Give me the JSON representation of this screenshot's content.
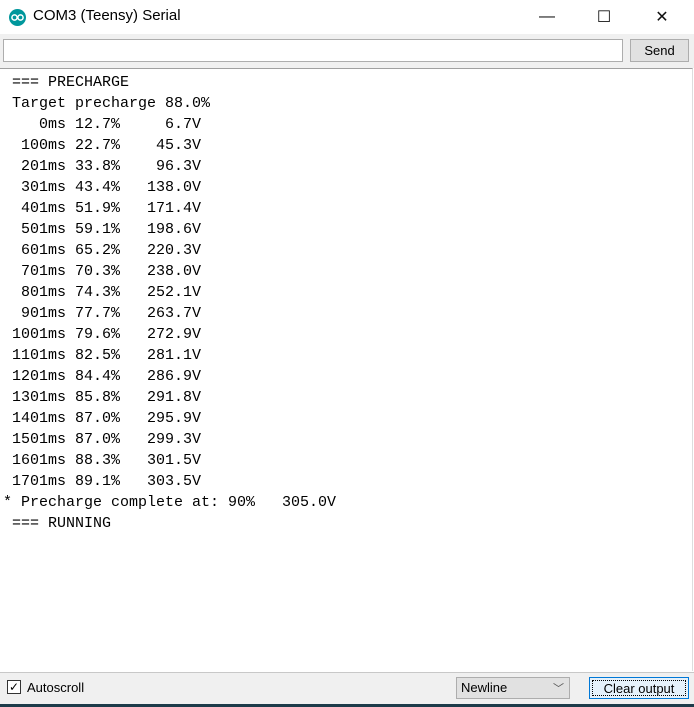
{
  "window": {
    "title": "COM3 (Teensy) Serial",
    "minimize": "—",
    "maximize": "☐",
    "close": "✕"
  },
  "toolbar": {
    "input_value": "",
    "send_label": "Send"
  },
  "output": {
    "lines": [
      " === PRECHARGE",
      " Target precharge 88.0%",
      "    0ms 12.7%     6.7V",
      "  100ms 22.7%    45.3V",
      "  201ms 33.8%    96.3V",
      "  301ms 43.4%   138.0V",
      "  401ms 51.9%   171.4V",
      "  501ms 59.1%   198.6V",
      "  601ms 65.2%   220.3V",
      "  701ms 70.3%   238.0V",
      "  801ms 74.3%   252.1V",
      "  901ms 77.7%   263.7V",
      " 1001ms 79.6%   272.9V",
      " 1101ms 82.5%   281.1V",
      " 1201ms 84.4%   286.9V",
      " 1301ms 85.8%   291.8V",
      " 1401ms 87.0%   295.9V",
      " 1501ms 87.0%   299.3V",
      " 1601ms 88.3%   301.5V",
      " 1701ms 89.1%   303.5V",
      "* Precharge complete at: 90%   305.0V",
      " === RUNNING"
    ]
  },
  "bottom": {
    "autoscroll_label": "Autoscroll",
    "autoscroll_checked": true,
    "line_ending": "Newline",
    "clear_label": "Clear output"
  }
}
